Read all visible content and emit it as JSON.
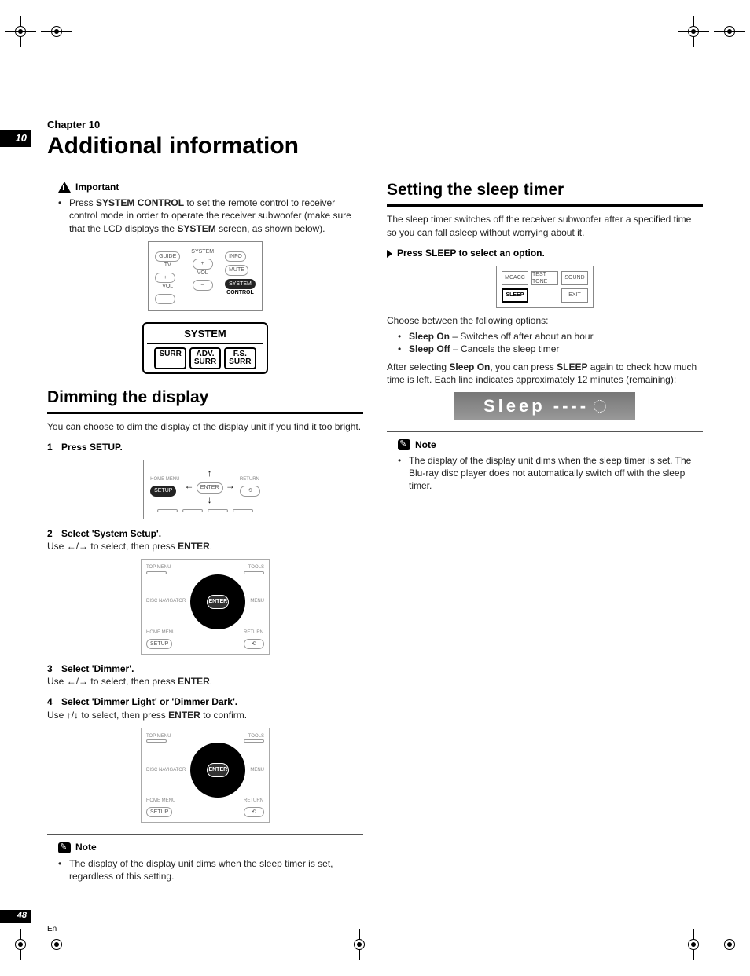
{
  "chapter": {
    "number": "10",
    "label": "Chapter 10",
    "title": "Additional information"
  },
  "left": {
    "important_label": "Important",
    "important_text_a": "Press ",
    "important_bold_a": "SYSTEM CONTROL",
    "important_text_b": " to set the remote control to receiver control mode in order to operate the receiver subwoofer (make sure that the LCD displays the ",
    "important_bold_b": "SYSTEM",
    "important_text_c": " screen, as shown below).",
    "remote1": {
      "guide": "GUIDE",
      "tv": "TV",
      "vol": "VOL",
      "system": "SYSTEM",
      "volplus": "+",
      "volminus": "–",
      "info": "INFO",
      "mute": "MUTE",
      "syscontrol": "SYSTEM",
      "control": "CONTROL"
    },
    "lcd": {
      "title": "SYSTEM",
      "surr": "SURR",
      "adv": "ADV.\nSURR",
      "fs": "F.S.\nSURR"
    },
    "sec1_title": "Dimming the display",
    "sec1_intro": "You can choose to dim the display of the display unit if you find it too bright.",
    "step1_num": "1",
    "step1_head": "Press SETUP.",
    "remote2": {
      "enter": "ENTER",
      "home": "HOME MENU",
      "setup": "SETUP",
      "return": "RETURN"
    },
    "step2_num": "2",
    "step2_head": "Select 'System Setup'.",
    "step2_desc_a": "Use ",
    "step2_desc_arrows": "←/→",
    "step2_desc_b": " to select, then press ",
    "step2_desc_bold": "ENTER",
    "step2_desc_c": ".",
    "nav": {
      "top": "TOP MENU",
      "tools": "TOOLS",
      "disc": "DISC NAVIGATOR",
      "menu": "MENU",
      "home": "HOME MENU",
      "setup": "SETUP",
      "return": "RETURN",
      "enter": "ENTER"
    },
    "step3_num": "3",
    "step3_head": "Select 'Dimmer'.",
    "step3_desc_a": "Use ",
    "step3_desc_arrows": "←/→",
    "step3_desc_b": " to select, then press ",
    "step3_desc_bold": "ENTER",
    "step3_desc_c": ".",
    "step4_num": "4",
    "step4_head": "Select 'Dimmer Light' or 'Dimmer Dark'.",
    "step4_desc_a": "Use ",
    "step4_desc_arrows": "↑/↓",
    "step4_desc_b": " to select, then press ",
    "step4_desc_bold": "ENTER",
    "step4_desc_c": " to confirm.",
    "note_label": "Note",
    "note_text": "The display of the display unit dims when the sleep timer is set, regardless of this setting."
  },
  "right": {
    "sec_title": "Setting the sleep timer",
    "intro": "The sleep timer switches off the receiver subwoofer after a specified time so you can fall asleep without worrying about it.",
    "step_head": "Press SLEEP to select an option.",
    "grid": {
      "mcacc": "MCACC",
      "test": "TEST TONE",
      "sound": "SOUND",
      "sleep": "SLEEP",
      "exit": "EXIT"
    },
    "choose": "Choose between the following options:",
    "opt1_bold": "Sleep On",
    "opt1_text": " – Switches off after about an hour",
    "opt2_bold": "Sleep Off",
    "opt2_text": " – Cancels the sleep timer",
    "after_a": "After selecting ",
    "after_bold1": "Sleep On",
    "after_b": ", you can press ",
    "after_bold2": "SLEEP",
    "after_c": " again to check how much time is left. Each line indicates approximately 12 minutes (remaining):",
    "display": "Sleep ----",
    "note_label": "Note",
    "note_text": "The display of the display unit dims when the sleep timer is set. The Blu-ray disc player does not automatically switch off with the sleep timer."
  },
  "footer": {
    "page": "48",
    "lang": "En"
  }
}
